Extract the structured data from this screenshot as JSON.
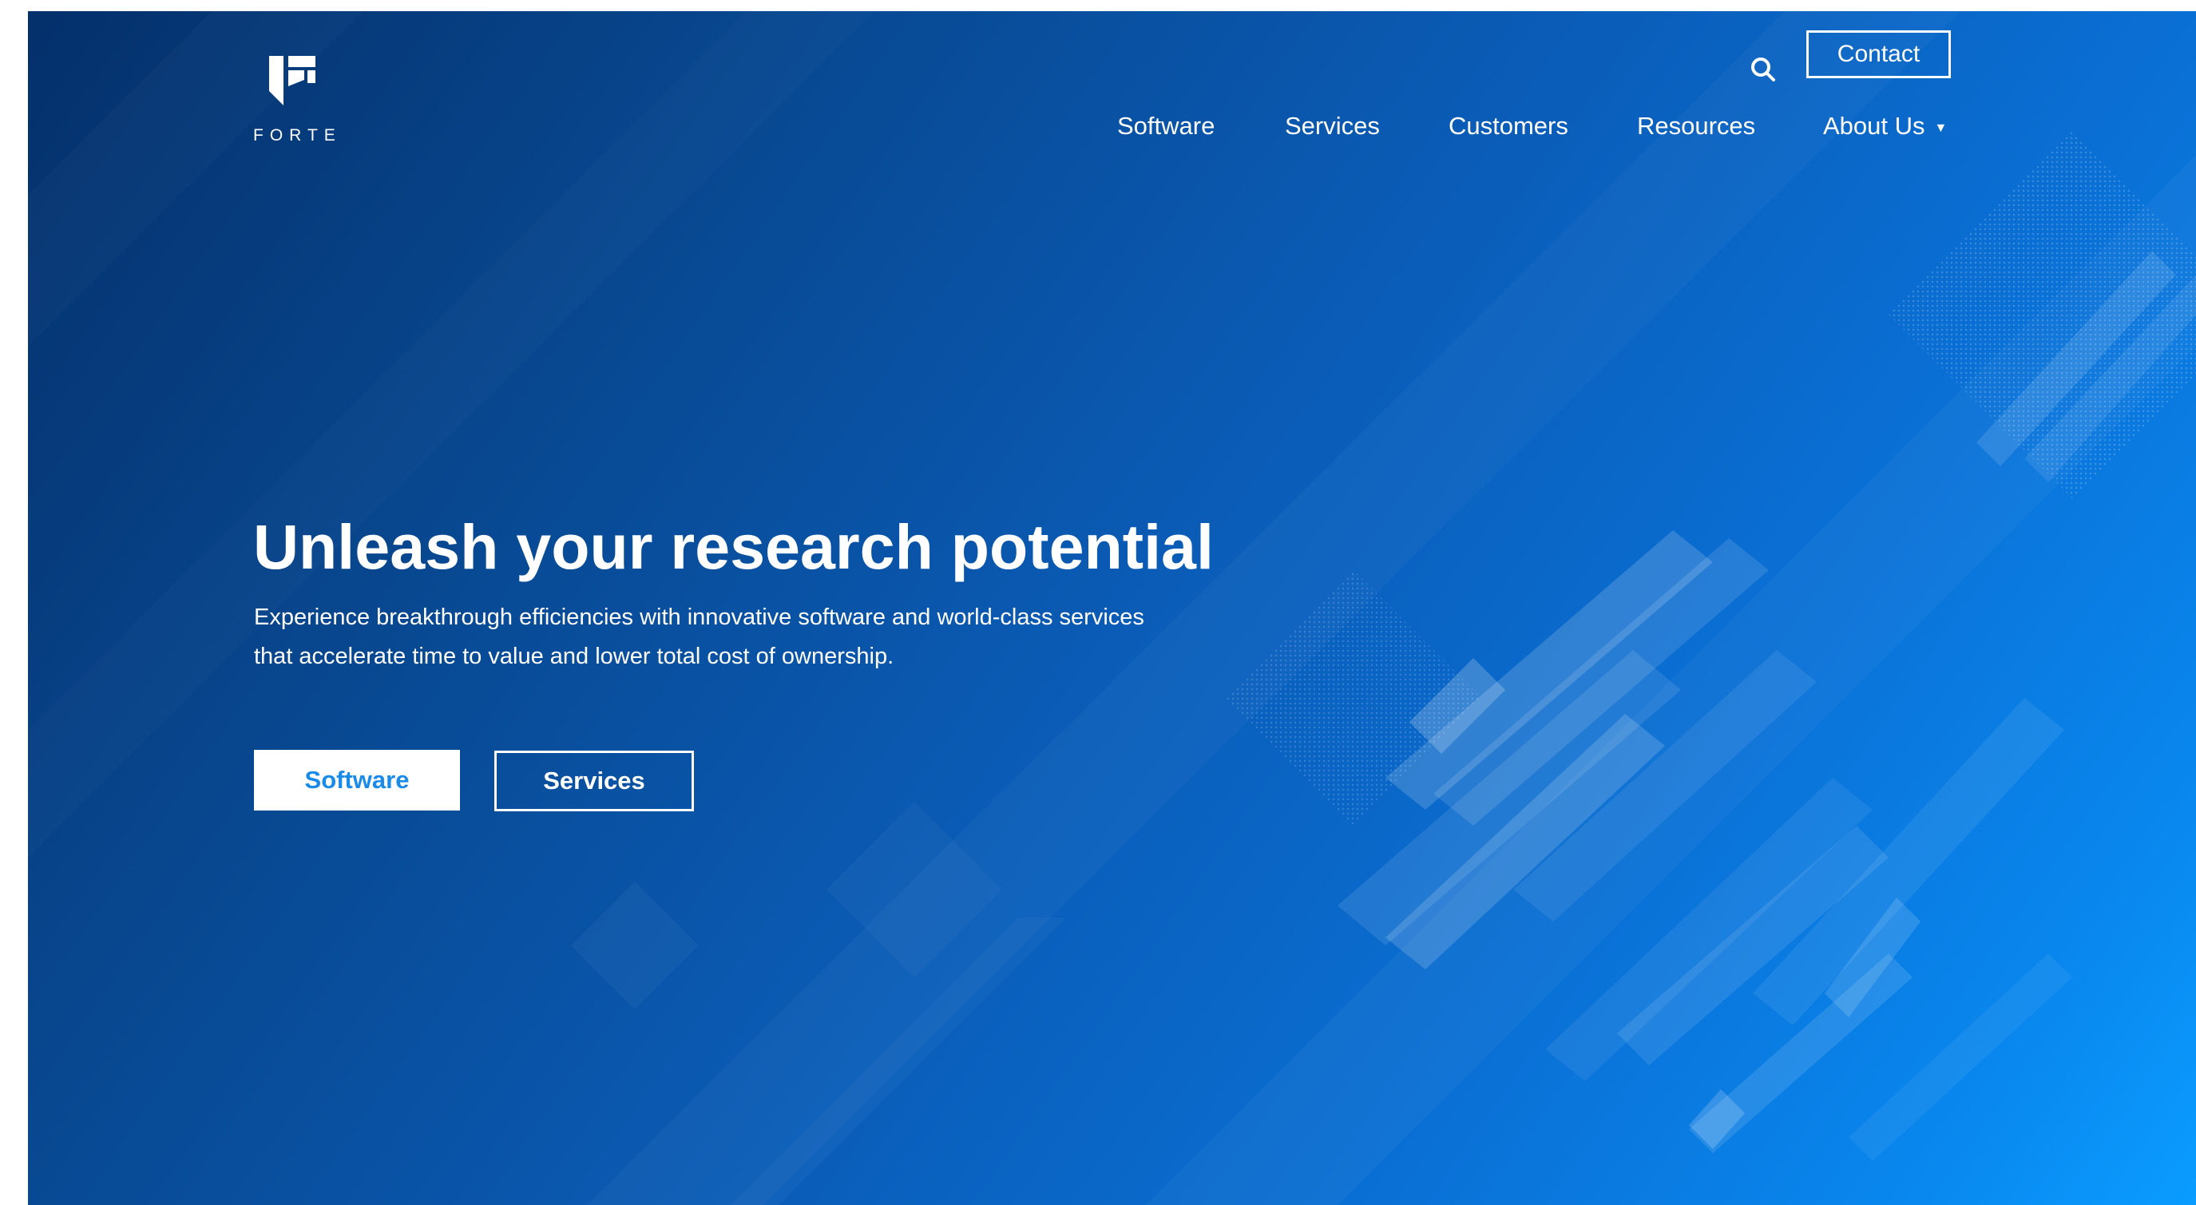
{
  "brand": {
    "name": "FORTE",
    "logo_icon": "forte-logo-icon"
  },
  "header": {
    "search_icon": "search-icon",
    "contact_label": "Contact",
    "nav": [
      {
        "label": "Software"
      },
      {
        "label": "Services"
      },
      {
        "label": "Customers"
      },
      {
        "label": "Resources"
      },
      {
        "label": "About Us",
        "has_dropdown": true,
        "dropdown_icon": "chevron-down-icon"
      }
    ]
  },
  "hero": {
    "title": "Unleash your research potential",
    "subtitle_line1": "Experience breakthrough efficiencies with innovative software and world-class services",
    "subtitle_line2": "that accelerate time to value and lower total cost of ownership.",
    "primary_button": "Software",
    "secondary_button": "Services"
  },
  "colors": {
    "background_dark": "#04306b",
    "background_mid": "#0a5bb5",
    "background_light": "#0a9cff",
    "primary_button_text": "#1a8be8",
    "text": "#ffffff"
  }
}
